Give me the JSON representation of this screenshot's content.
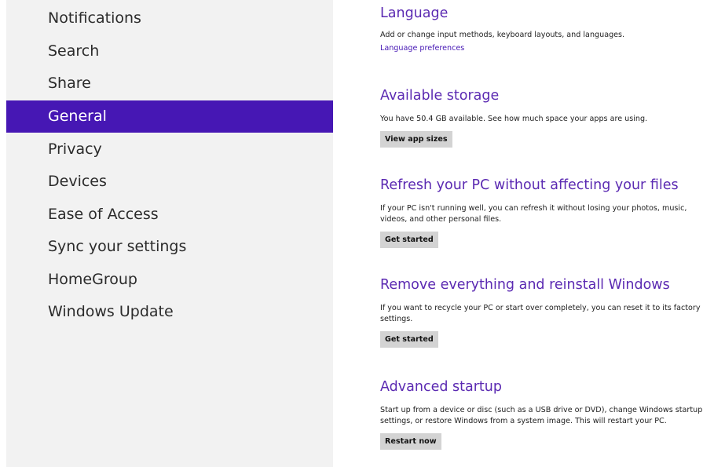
{
  "sidebar": {
    "items": [
      {
        "label": "Notifications"
      },
      {
        "label": "Search"
      },
      {
        "label": "Share"
      },
      {
        "label": "General"
      },
      {
        "label": "Privacy"
      },
      {
        "label": "Devices"
      },
      {
        "label": "Ease of Access"
      },
      {
        "label": "Sync your settings"
      },
      {
        "label": "HomeGroup"
      },
      {
        "label": "Windows Update"
      }
    ],
    "selected": "General"
  },
  "sections": {
    "language": {
      "title": "Language",
      "description": "Add or change input methods, keyboard layouts, and languages.",
      "link": "Language preferences"
    },
    "storage": {
      "title": "Available storage",
      "description": "You have 50.4 GB available. See how much space your apps are using.",
      "button": "View app sizes"
    },
    "refresh": {
      "title": "Refresh your PC without affecting your files",
      "description": "If your PC isn't running well, you can refresh it without losing your photos, music, videos, and other personal files.",
      "button": "Get started"
    },
    "reset": {
      "title": "Remove everything and reinstall Windows",
      "description": "If you want to recycle your PC or start over completely, you can reset it to its factory settings.",
      "button": "Get started"
    },
    "advanced": {
      "title": "Advanced startup",
      "description": "Start up from a device or disc (such as a USB drive or DVD), change Windows startup settings, or restore Windows from a system image. This will restart your PC.",
      "button": "Restart now"
    }
  },
  "colors": {
    "accent": "#4617b4",
    "heading": "#5b2ab2",
    "sidebar_bg": "#f2f2f2",
    "button_bg": "#d3d3d3"
  }
}
